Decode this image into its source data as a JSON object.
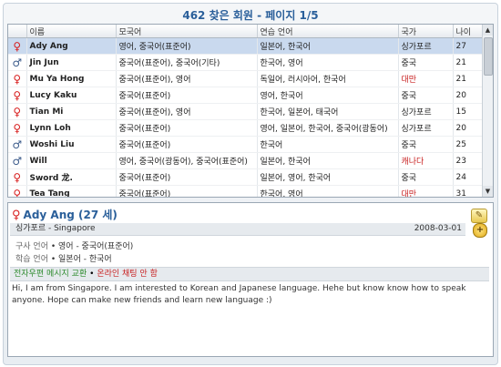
{
  "title": "462 찾은 회원 - 페이지 1/5",
  "columns": {
    "name": "이름",
    "native": "모국어",
    "practice": "연습 언어",
    "country": "국가",
    "age": "나이"
  },
  "rows": [
    {
      "gender": "female",
      "name": "Ady Ang",
      "native": "영어, 중국어(표준어)",
      "practice": "일본어, 한국어",
      "country": "싱가포르",
      "age": "27",
      "selected": true
    },
    {
      "gender": "male",
      "name": "Jin Jun",
      "native": "중국어(표준어), 중국어(기타)",
      "practice": "한국어, 영어",
      "country": "중국",
      "age": "21"
    },
    {
      "gender": "female",
      "name": "Mu Ya Hong",
      "native": "중국어(표준어), 영어",
      "practice": "독일어, 러시아어, 한국어",
      "country": "대만",
      "age": "21"
    },
    {
      "gender": "female",
      "name": "Lucy Kaku",
      "native": "중국어(표준어)",
      "practice": "영어, 한국어",
      "country": "중국",
      "age": "20"
    },
    {
      "gender": "female",
      "name": "Tian Mi",
      "native": "중국어(표준어), 영어",
      "practice": "한국어, 일본어, 태국어",
      "country": "싱가포르",
      "age": "15"
    },
    {
      "gender": "female",
      "name": "Lynn Loh",
      "native": "중국어(표준어)",
      "practice": "영어, 일본어, 한국어, 중국어(광동어)",
      "country": "싱가포르",
      "age": "20"
    },
    {
      "gender": "male",
      "name": "Woshi Liu",
      "native": "중국어(표준어)",
      "practice": "한국어",
      "country": "중국",
      "age": "25"
    },
    {
      "gender": "male",
      "name": "Will",
      "native": "영어, 중국어(광동어), 중국어(표준어)",
      "practice": "일본어, 한국어",
      "country": "캐나다",
      "age": "23"
    },
    {
      "gender": "female",
      "name": "Sword 龙.",
      "native": "중국어(표준어)",
      "practice": "일본어, 영어, 한국어",
      "country": "중국",
      "age": "24"
    },
    {
      "gender": "female",
      "name": "Tea Tang",
      "native": "중국어(표준어)",
      "practice": "한국어, 영어",
      "country": "대만",
      "age": "31"
    }
  ],
  "gender_glyphs": {
    "female": "♀",
    "male": "♂"
  },
  "detail": {
    "name_age": "Ady Ang  (27 세)",
    "location": "싱가포르 - Singapore",
    "date": "2008-03-01",
    "speaks_label": "구사 언어",
    "speaks": "영어 - 중국어(표준어)",
    "learns_label": "학습 언어",
    "learns": "일본어 - 한국어",
    "contact_mail": "전자우편 메시지 교환",
    "contact_sep": "•",
    "contact_chat": "온라인 채팅 안 함",
    "intro": "Hi, I am from Singapore. I am interested to Korean and Japanese language. Hehe but  know know how to speak anyone. Hope can make new friends and learn new language :)"
  },
  "colors": {
    "accent": "#2a5f9a",
    "female": "#d82020",
    "selected_row": "#c9d9ee",
    "country_green": "#2e8b2e",
    "country_red": "#c82020"
  },
  "icons": {
    "female": "female-icon",
    "male": "male-icon",
    "note": "note-icon",
    "add": "add-contact-icon"
  }
}
